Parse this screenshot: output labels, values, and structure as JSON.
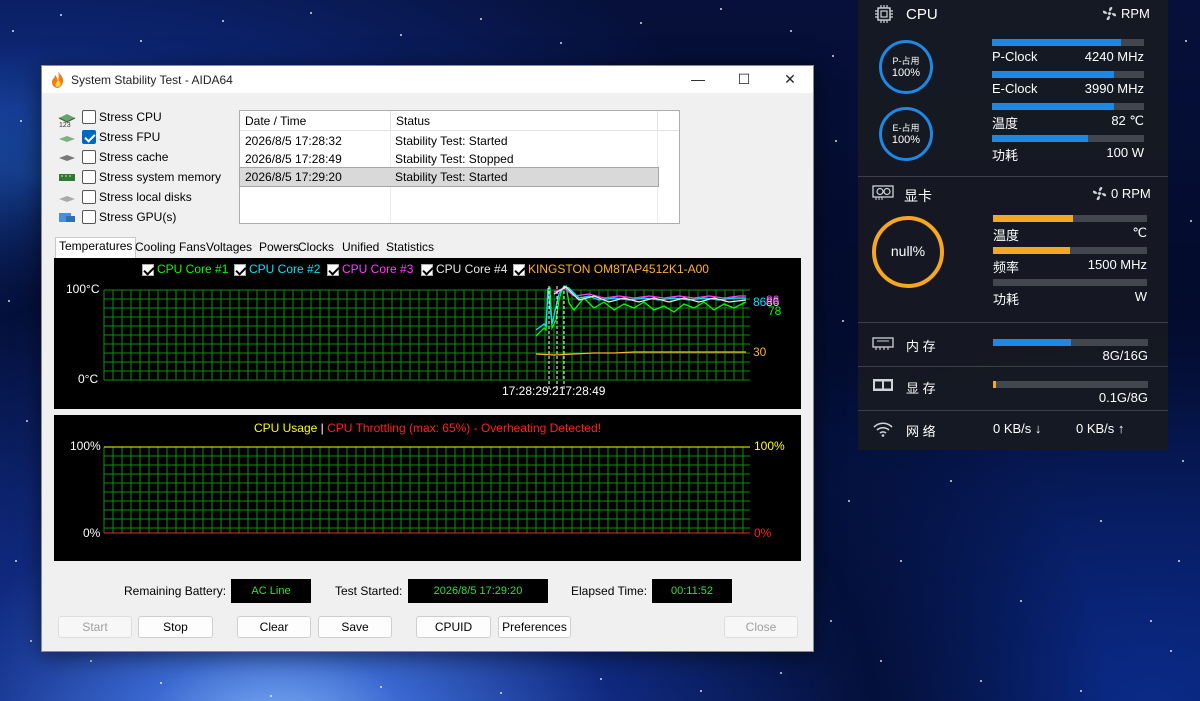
{
  "window": {
    "title": "System Stability Test - AIDA64",
    "controls": {
      "minimize": "—",
      "maximize": "☐",
      "close": "✕"
    }
  },
  "stress_options": [
    {
      "label": "Stress CPU",
      "checked": false,
      "icon": "cpu-chip-icon"
    },
    {
      "label": "Stress FPU",
      "checked": true,
      "icon": "fpu-123-icon"
    },
    {
      "label": "Stress cache",
      "checked": false,
      "icon": "cache-icon"
    },
    {
      "label": "Stress system memory",
      "checked": false,
      "icon": "memory-module-icon"
    },
    {
      "label": "Stress local disks",
      "checked": false,
      "icon": "disk-icon"
    },
    {
      "label": "Stress GPU(s)",
      "checked": false,
      "icon": "gpu-icon"
    }
  ],
  "log": {
    "columns": [
      "Date / Time",
      "Status"
    ],
    "rows": [
      {
        "time": "2026/8/5 17:28:32",
        "status": "Stability Test: Started",
        "selected": false
      },
      {
        "time": "2026/8/5 17:28:49",
        "status": "Stability Test: Stopped",
        "selected": false
      },
      {
        "time": "2026/8/5 17:29:20",
        "status": "Stability Test: Started",
        "selected": true
      }
    ]
  },
  "tabs": [
    {
      "label": "Temperatures",
      "active": true
    },
    {
      "label": "Cooling Fans",
      "active": false
    },
    {
      "label": "Voltages",
      "active": false
    },
    {
      "label": "Powers",
      "active": false
    },
    {
      "label": "Clocks",
      "active": false
    },
    {
      "label": "Unified",
      "active": false
    },
    {
      "label": "Statistics",
      "active": false
    }
  ],
  "temp_graph": {
    "legend": [
      {
        "label": "CPU Core #1",
        "color": "#00ff00"
      },
      {
        "label": "CPU Core #2",
        "color": "#00e5ff"
      },
      {
        "label": "CPU Core #3",
        "color": "#ff3cff"
      },
      {
        "label": "CPU Core #4",
        "color": "#e8e8e8"
      },
      {
        "label": "KINGSTON OM8TAP4512K1-A00",
        "color": "#ffb030"
      }
    ],
    "y_top": "100°C",
    "y_bottom": "0°C",
    "time_labels": "17:28:29:217:28:49",
    "end_values": [
      {
        "text": "86",
        "color": "#00e5ff"
      },
      {
        "text": "86",
        "color": "#e8e8e8"
      },
      {
        "text": "86",
        "color": "#ff3cff"
      },
      {
        "text": "78",
        "color": "#00ff00"
      },
      {
        "text": "30",
        "color": "#ffb030"
      }
    ]
  },
  "usage_graph": {
    "title_usage": "CPU Usage",
    "separator": "|",
    "title_throttle": "CPU Throttling (max: 65%) - Overheating Detected!",
    "y_left_top": "100%",
    "y_left_bottom": "0%",
    "y_right_top": "100%",
    "y_right_bottom": "0%"
  },
  "status_bar": {
    "battery_label": "Remaining Battery:",
    "battery_value": "AC Line",
    "started_label": "Test Started:",
    "started_value": "2026/8/5 17:29:20",
    "elapsed_label": "Elapsed Time:",
    "elapsed_value": "00:11:52"
  },
  "buttons": {
    "start": "Start",
    "stop": "Stop",
    "clear": "Clear",
    "save": "Save",
    "cpuid": "CPUID",
    "preferences": "Preferences",
    "close": "Close"
  },
  "monitor": {
    "cpu": {
      "title": "CPU",
      "fan": "RPM",
      "p_ring_label": "P-占用",
      "p_ring_value": "100%",
      "e_ring_label": "E-占用",
      "e_ring_value": "100%",
      "metrics": [
        {
          "label": "P-Clock",
          "value": "4240 MHz",
          "fill": 0.85
        },
        {
          "label": "E-Clock",
          "value": "3990 MHz",
          "fill": 0.8
        },
        {
          "label": "温度",
          "value": "82 ℃",
          "fill": 0.8
        },
        {
          "label": "功耗",
          "value": "100 W",
          "fill": 0.63
        }
      ],
      "accent": "#1e88e5"
    },
    "gpu": {
      "title": "显卡",
      "fan": "0 RPM",
      "ring_value": "null%",
      "metrics": [
        {
          "label": "温度",
          "value": "℃",
          "fill": 0.52
        },
        {
          "label": "频率",
          "value": "1500 MHz",
          "fill": 0.5
        },
        {
          "label": "功耗",
          "value": "W",
          "fill": 0.0
        }
      ],
      "accent": "#f5a623"
    },
    "memory": {
      "label": "内 存",
      "value": "8G/16G",
      "fill": 0.5
    },
    "vram": {
      "label": "显 存",
      "value": "0.1G/8G",
      "fill": 0.02
    },
    "network": {
      "label": "网 络",
      "down": "0 KB/s ↓",
      "up": "0 KB/s ↑"
    }
  }
}
